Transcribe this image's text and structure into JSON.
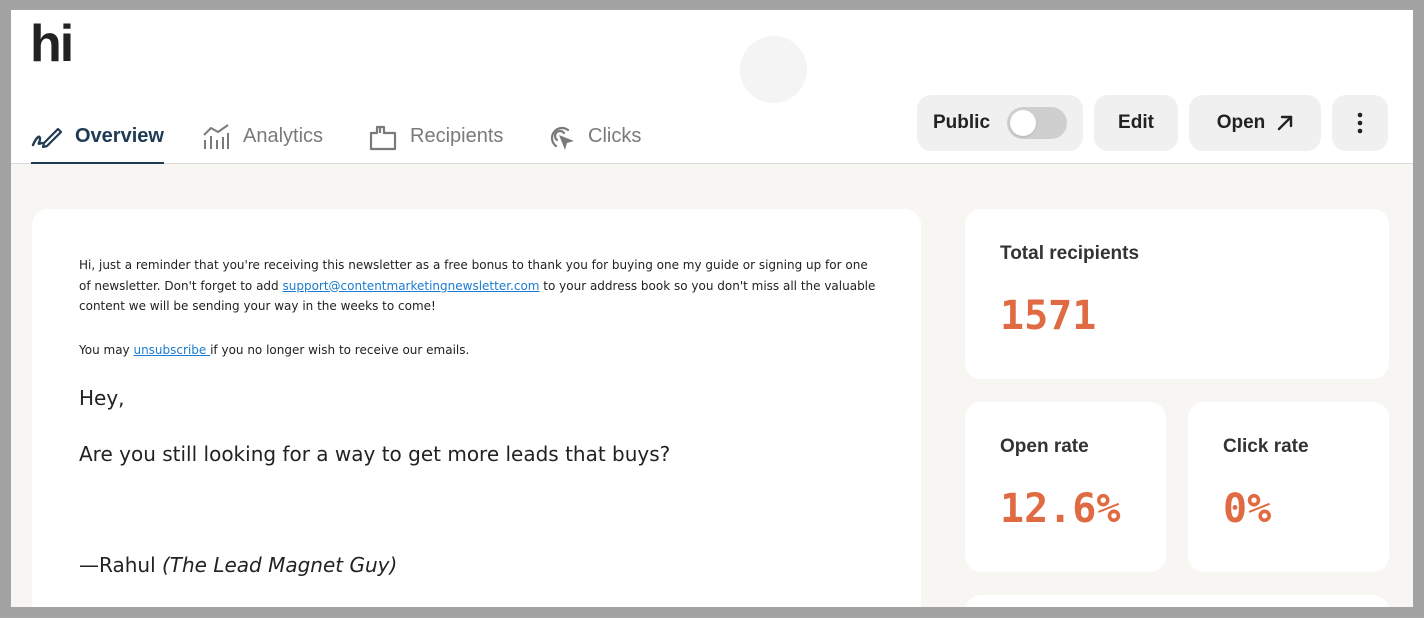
{
  "app": {
    "logo": "hi"
  },
  "tabs": [
    {
      "label": "Overview",
      "icon": "signature-pen-icon",
      "active": true
    },
    {
      "label": "Analytics",
      "icon": "bar-chart-icon",
      "active": false
    },
    {
      "label": "Recipients",
      "icon": "folder-icon",
      "active": false
    },
    {
      "label": "Clicks",
      "icon": "cursor-click-icon",
      "active": false
    }
  ],
  "actions": {
    "public_label": "Public",
    "public_enabled": false,
    "edit_label": "Edit",
    "open_label": "Open",
    "more_icon": "more-vertical-icon"
  },
  "email": {
    "preheader_intro": "Hi, just a reminder that you're receiving this newsletter as a free bonus to thank you for buying one my guide or signing up for one of newsletter. Don't forget to add ",
    "support_email": "support@contentmarketingnewsletter.com",
    "preheader_outro": " to your address book so you don't miss all the valuable content we will be sending your way in the weeks to come!",
    "unsub_prefix": "You may ",
    "unsub_link": "unsubscribe ",
    "unsub_suffix": "if you no longer wish to receive our emails.",
    "greeting": "Hey,",
    "question": "Are you still looking for a way to get more leads that buys?",
    "signature_name": "—Rahul ",
    "signature_title": "(The Lead Magnet Guy)"
  },
  "stats": {
    "total_label": "Total recipients",
    "total_value": "1571",
    "open_label": "Open rate",
    "open_value": "12.6%",
    "click_label": "Click rate",
    "click_value": "0%"
  },
  "colors": {
    "accent": "#e06b43",
    "active_tab": "#1f3b54",
    "link": "#1a7bd1",
    "content_bg": "#f7f6f3"
  }
}
